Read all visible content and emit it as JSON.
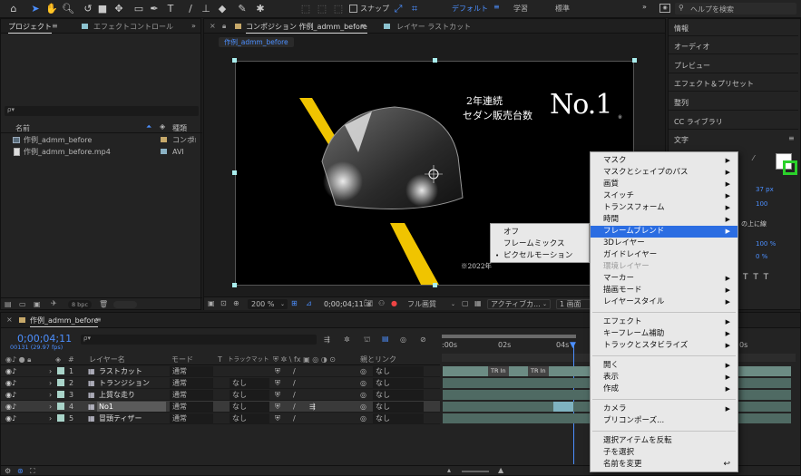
{
  "toolbar": {
    "snap_label": "スナップ",
    "workspaces": [
      "デフォルト",
      "学習",
      "標準"
    ],
    "search_placeholder": "ヘルプを検索"
  },
  "project": {
    "tab": "プロジェクト",
    "effects_tab": "エフェクトコントロール",
    "search_prefix": "ρ▾",
    "col_name": "名前",
    "col_type": "種類",
    "items": [
      {
        "name": "作例_admm_before",
        "type": "コンポ",
        "color": "#c7a96a"
      },
      {
        "name": "作例_admm_before.mp4",
        "type": "AVI",
        "color": "#8bb2c4"
      }
    ],
    "bpc": "8 bpc"
  },
  "composition": {
    "tab_label": "コンポジション 作例_admm_before",
    "layer_tab": "レイヤー ラストカット",
    "flow_tab": "作例_admm_before",
    "zoom": "200 %",
    "timecode": "0;00;04;11",
    "quality": "フル画質",
    "camera": "アクティブカ...",
    "views": "1 画面",
    "overlay": {
      "subtitle1": "2年連続",
      "subtitle2": "セダン販売台数",
      "big": "No.1",
      "star": "※",
      "footnote": "※2022年"
    }
  },
  "right_panel": {
    "items": [
      "情報",
      "オーディオ",
      "プレビュー",
      "エフェクト＆プリセット",
      "整列",
      "CC ライブラリ",
      "文字"
    ],
    "char_values": {
      "size": "37 px",
      "tracking": "100",
      "scale": "100 %",
      "baseline": "0 %",
      "blend": "の上に線"
    }
  },
  "timeline": {
    "comp_name": "作例_admm_before",
    "timecode": "0;00;04;11",
    "frames": "00131 (29.97 fps)",
    "headers": {
      "layer": "レイヤー名",
      "mode": "モード",
      "t": "T",
      "trackmatte": "トラックマット",
      "parent": "親とリンク"
    },
    "ruler": [
      ":00s",
      "02s",
      "04s",
      "0s"
    ],
    "layers": [
      {
        "num": "1",
        "name": "ラストカット",
        "mode": "通常",
        "matte": "",
        "parent": "なし",
        "color": "#a9d4c9",
        "icon": "▦"
      },
      {
        "num": "2",
        "name": "トランジション",
        "mode": "通常",
        "matte": "なし",
        "parent": "なし",
        "color": "#a9d4c9",
        "icon": "▦"
      },
      {
        "num": "3",
        "name": "上質な走り",
        "mode": "通常",
        "matte": "なし",
        "parent": "なし",
        "color": "#a9d4c9",
        "icon": "▦"
      },
      {
        "num": "4",
        "name": "No1",
        "mode": "通常",
        "matte": "なし",
        "parent": "なし",
        "color": "#a9d4c9",
        "icon": "▦"
      },
      {
        "num": "5",
        "name": "冒頭ティザー",
        "mode": "通常",
        "matte": "なし",
        "parent": "なし",
        "color": "#a9d4c9",
        "icon": "▦"
      }
    ],
    "marker": "TR In"
  },
  "context_menu": {
    "items": [
      {
        "label": "マスク",
        "sub": true
      },
      {
        "label": "マスクとシェイプのパス",
        "sub": true
      },
      {
        "label": "画質",
        "sub": true
      },
      {
        "label": "スイッチ",
        "sub": true
      },
      {
        "label": "トランスフォーム",
        "sub": true
      },
      {
        "label": "時間",
        "sub": true
      },
      {
        "label": "フレームブレンド",
        "sub": true,
        "selected": true
      },
      {
        "label": "3Dレイヤー",
        "sub": false
      },
      {
        "label": "ガイドレイヤー",
        "sub": false
      },
      {
        "label": "環境レイヤー",
        "sub": false,
        "disabled": true
      },
      {
        "label": "マーカー",
        "sub": true
      },
      {
        "label": "描画モード",
        "sub": true
      },
      {
        "label": "レイヤースタイル",
        "sub": true
      },
      {
        "label": "エフェクト",
        "sub": true,
        "sep_before": true
      },
      {
        "label": "キーフレーム補助",
        "sub": true
      },
      {
        "label": "トラックとスタビライズ",
        "sub": true
      },
      {
        "label": "開く",
        "sub": true,
        "sep_before": true
      },
      {
        "label": "表示",
        "sub": true
      },
      {
        "label": "作成",
        "sub": true
      },
      {
        "label": "カメラ",
        "sub": true,
        "sep_before": true
      },
      {
        "label": "プリコンポーズ...",
        "sub": false
      },
      {
        "label": "選択アイテムを反転",
        "sub": false,
        "sep_before": true
      },
      {
        "label": "子を選択",
        "sub": false
      },
      {
        "label": "名前を変更",
        "sub": false,
        "shortcut": "↩"
      }
    ]
  },
  "submenu": {
    "items": [
      {
        "label": "オフ",
        "checked": false
      },
      {
        "label": "フレームミックス",
        "checked": false
      },
      {
        "label": "ピクセルモーション",
        "checked": true
      }
    ]
  }
}
